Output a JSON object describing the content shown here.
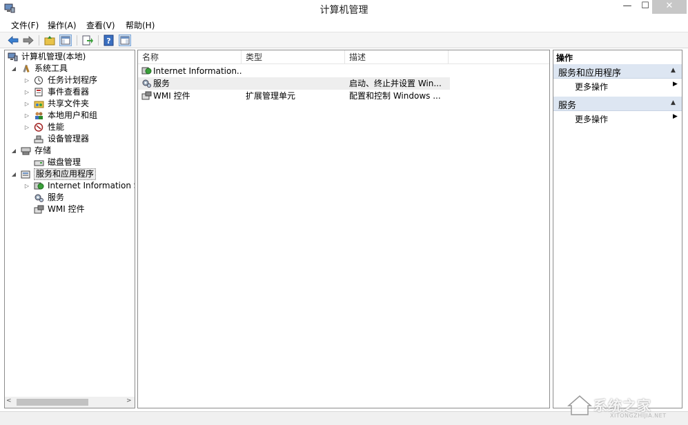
{
  "window": {
    "title": "计算机管理",
    "minimize": "—",
    "maximize": "☐",
    "close": "✕"
  },
  "menu": [
    {
      "label": "文件(F)"
    },
    {
      "label": "操作(A)"
    },
    {
      "label": "查看(V)"
    },
    {
      "label": "帮助(H)"
    }
  ],
  "toolbar": {
    "buttons": [
      "back-arrow-icon",
      "forward-arrow-icon",
      "up-folder-icon",
      "show-hide-console-tree-icon",
      "export-list-icon",
      "help-icon",
      "show-hide-action-pane-icon"
    ]
  },
  "tree": {
    "root": "计算机管理(本地)",
    "system_tools": "系统工具",
    "task_scheduler": "任务计划程序",
    "event_viewer": "事件查看器",
    "shared_folders": "共享文件夹",
    "local_users": "本地用户和组",
    "performance": "性能",
    "device_manager": "设备管理器",
    "storage": "存储",
    "disk_management": "磁盘管理",
    "services_apps": "服务和应用程序",
    "iis": "Internet Information S",
    "services": "服务",
    "wmi": "WMI 控件",
    "scroll_left": "<",
    "scroll_right": ">"
  },
  "list": {
    "columns": [
      "名称",
      "类型",
      "描述"
    ],
    "rows": [
      {
        "name": "Internet Information...",
        "type": "",
        "desc": ""
      },
      {
        "name": "服务",
        "type": "",
        "desc": "启动、终止并设置 Win..."
      },
      {
        "name": "WMI 控件",
        "type": "扩展管理单元",
        "desc": "配置和控制 Windows ..."
      }
    ]
  },
  "actions": {
    "title": "操作",
    "sections": [
      {
        "label": "服务和应用程序",
        "item": "更多操作"
      },
      {
        "label": "服务",
        "item": "更多操作"
      }
    ],
    "collapse_glyph": "▲",
    "arrow_glyph": "▶"
  },
  "watermark": {
    "text": "系统之家",
    "sub": "XITONGZHIJIA.NET"
  }
}
